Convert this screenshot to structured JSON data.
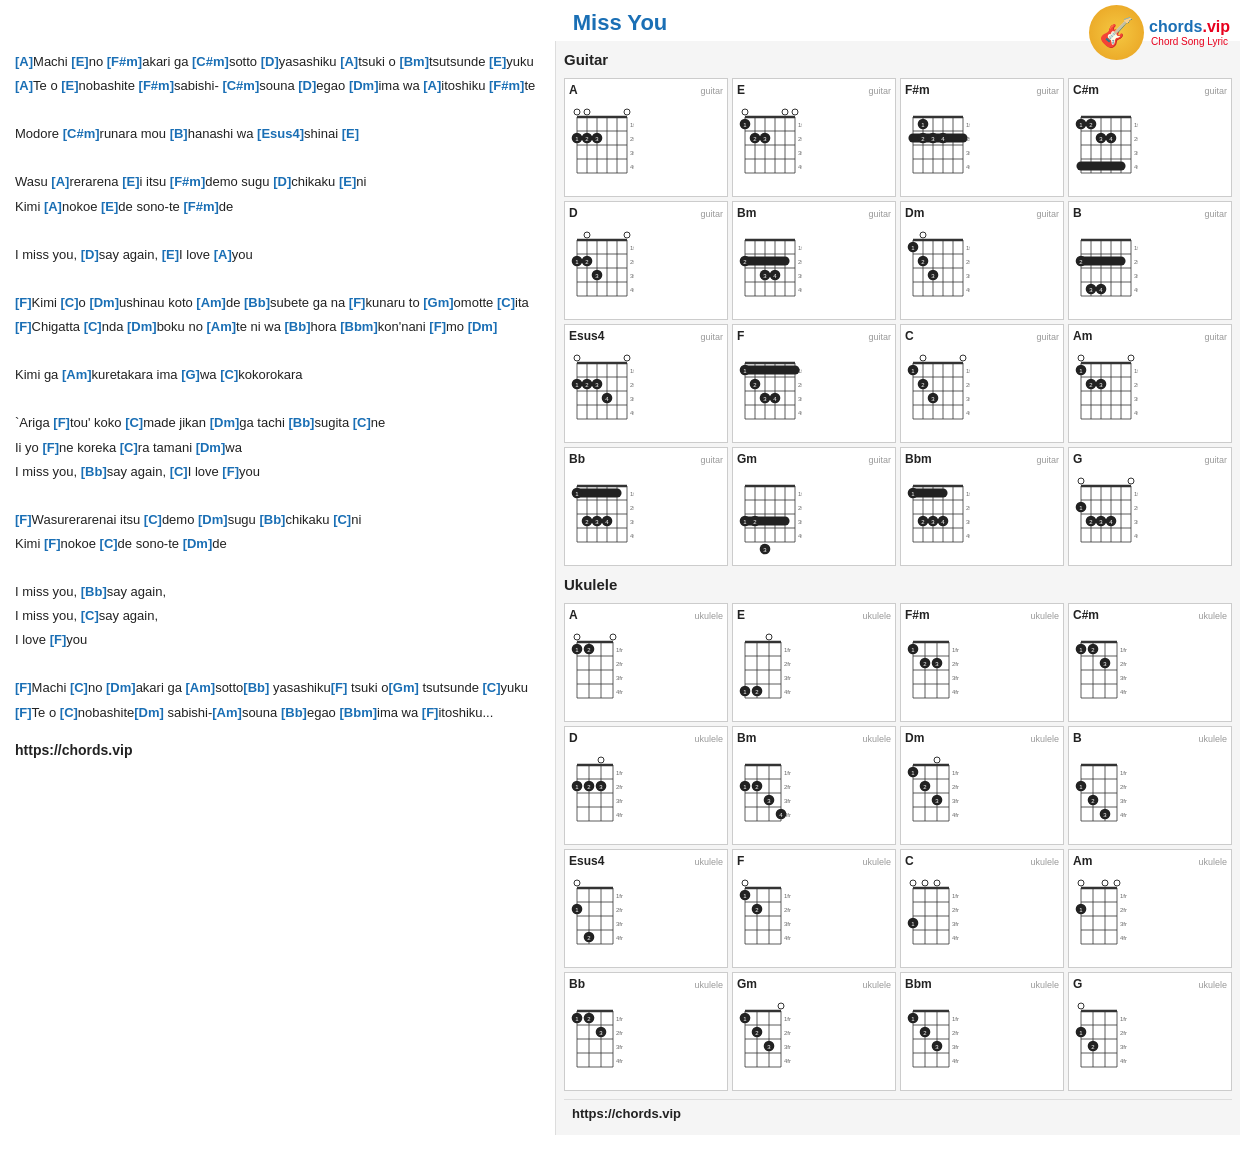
{
  "header": {
    "title": "Miss You",
    "logo_icon": "🎸",
    "logo_brand": "chords",
    "logo_brand_accent": ".vip",
    "logo_subtitle": "Chord Song Lyric"
  },
  "lyrics": {
    "lines": [
      {
        "parts": [
          {
            "type": "chord",
            "text": "[A]"
          },
          {
            "type": "text",
            "text": "Machi "
          },
          {
            "type": "chord",
            "text": "[E]"
          },
          {
            "type": "text",
            "text": "no "
          },
          {
            "type": "chord",
            "text": "[F#m]"
          },
          {
            "type": "text",
            "text": "akari ga "
          },
          {
            "type": "chord",
            "text": "[C#m]"
          },
          {
            "type": "text",
            "text": "sotto "
          },
          {
            "type": "chord",
            "text": "[D]"
          },
          {
            "type": "text",
            "text": "yasashiku "
          },
          {
            "type": "chord",
            "text": "[A]"
          },
          {
            "type": "text",
            "text": "tsuki o "
          },
          {
            "type": "chord",
            "text": "[Bm]"
          },
          {
            "type": "text",
            "text": "tsutsunde "
          },
          {
            "type": "chord",
            "text": "[E]"
          },
          {
            "type": "text",
            "text": "yuku"
          }
        ]
      },
      {
        "parts": [
          {
            "type": "chord",
            "text": "[A]"
          },
          {
            "type": "text",
            "text": "Te o "
          },
          {
            "type": "chord",
            "text": "[E]"
          },
          {
            "type": "text",
            "text": "nobashite "
          },
          {
            "type": "chord",
            "text": "[F#m]"
          },
          {
            "type": "text",
            "text": "sabishi- "
          },
          {
            "type": "chord",
            "text": "[C#m]"
          },
          {
            "type": "text",
            "text": "souna "
          },
          {
            "type": "chord",
            "text": "[D]"
          },
          {
            "type": "text",
            "text": "egao "
          },
          {
            "type": "chord",
            "text": "[Dm]"
          },
          {
            "type": "text",
            "text": "ima wa "
          },
          {
            "type": "chord",
            "text": "[A]"
          },
          {
            "type": "text",
            "text": "itoshiku "
          },
          {
            "type": "chord",
            "text": "[F#m]"
          },
          {
            "type": "text",
            "text": "te"
          }
        ]
      },
      {
        "parts": []
      },
      {
        "parts": [
          {
            "type": "text",
            "text": "Modore "
          },
          {
            "type": "chord",
            "text": "[C#m]"
          },
          {
            "type": "text",
            "text": "runara mou "
          },
          {
            "type": "chord",
            "text": "[B]"
          },
          {
            "type": "text",
            "text": "hanashi wa "
          },
          {
            "type": "chord",
            "text": "[Esus4]"
          },
          {
            "type": "text",
            "text": "shinai "
          },
          {
            "type": "chord",
            "text": "[E]"
          }
        ]
      },
      {
        "parts": []
      },
      {
        "parts": [
          {
            "type": "text",
            "text": "Wasu "
          },
          {
            "type": "chord",
            "text": "[A]"
          },
          {
            "type": "text",
            "text": "rerarena "
          },
          {
            "type": "chord",
            "text": "[E]"
          },
          {
            "type": "text",
            "text": "i itsu "
          },
          {
            "type": "chord",
            "text": "[F#m]"
          },
          {
            "type": "text",
            "text": "demo sugu "
          },
          {
            "type": "chord",
            "text": "[D]"
          },
          {
            "type": "text",
            "text": "chikaku "
          },
          {
            "type": "chord",
            "text": "[E]"
          },
          {
            "type": "text",
            "text": "ni"
          }
        ]
      },
      {
        "parts": [
          {
            "type": "text",
            "text": "Kimi "
          },
          {
            "type": "chord",
            "text": "[A]"
          },
          {
            "type": "text",
            "text": "nokoe "
          },
          {
            "type": "chord",
            "text": "[E]"
          },
          {
            "type": "text",
            "text": "de sono-te "
          },
          {
            "type": "chord",
            "text": "[F#m]"
          },
          {
            "type": "text",
            "text": "de"
          }
        ]
      },
      {
        "parts": []
      },
      {
        "parts": [
          {
            "type": "text",
            "text": "I miss you, "
          },
          {
            "type": "chord",
            "text": "[D]"
          },
          {
            "type": "text",
            "text": "say again, "
          },
          {
            "type": "chord",
            "text": "[E]"
          },
          {
            "type": "text",
            "text": "I love "
          },
          {
            "type": "chord",
            "text": "[A]"
          },
          {
            "type": "text",
            "text": "you"
          }
        ]
      },
      {
        "parts": []
      },
      {
        "parts": [
          {
            "type": "chord",
            "text": "[F]"
          },
          {
            "type": "text",
            "text": "Kimi "
          },
          {
            "type": "chord",
            "text": "[C]"
          },
          {
            "type": "text",
            "text": "o "
          },
          {
            "type": "chord",
            "text": "[Dm]"
          },
          {
            "type": "text",
            "text": "ushinau koto "
          },
          {
            "type": "chord",
            "text": "[Am]"
          },
          {
            "type": "text",
            "text": "de "
          },
          {
            "type": "chord",
            "text": "[Bb]"
          },
          {
            "type": "text",
            "text": "subete ga na "
          },
          {
            "type": "chord",
            "text": "[F]"
          },
          {
            "type": "text",
            "text": "kunaru to "
          },
          {
            "type": "chord",
            "text": "[Gm]"
          },
          {
            "type": "text",
            "text": "omotte "
          },
          {
            "type": "chord",
            "text": "[C]"
          },
          {
            "type": "text",
            "text": "ita"
          }
        ]
      },
      {
        "parts": [
          {
            "type": "chord",
            "text": "[F]"
          },
          {
            "type": "text",
            "text": "Chigatta "
          },
          {
            "type": "chord",
            "text": "[C]"
          },
          {
            "type": "text",
            "text": "nda "
          },
          {
            "type": "chord",
            "text": "[Dm]"
          },
          {
            "type": "text",
            "text": "boku no "
          },
          {
            "type": "chord",
            "text": "[Am]"
          },
          {
            "type": "text",
            "text": "te ni wa "
          },
          {
            "type": "chord",
            "text": "[Bb]"
          },
          {
            "type": "text",
            "text": "hora "
          },
          {
            "type": "chord",
            "text": "[Bbm]"
          },
          {
            "type": "text",
            "text": "kon'nani "
          },
          {
            "type": "chord",
            "text": "[F]"
          },
          {
            "type": "text",
            "text": "mo "
          },
          {
            "type": "chord",
            "text": "[Dm]"
          }
        ]
      },
      {
        "parts": []
      },
      {
        "parts": [
          {
            "type": "text",
            "text": "Kimi ga "
          },
          {
            "type": "chord",
            "text": "[Am]"
          },
          {
            "type": "text",
            "text": "kuretakara ima "
          },
          {
            "type": "chord",
            "text": "[G]"
          },
          {
            "type": "text",
            "text": "wa "
          },
          {
            "type": "chord",
            "text": "[C]"
          },
          {
            "type": "text",
            "text": "kokorokara"
          }
        ]
      },
      {
        "parts": []
      },
      {
        "parts": [
          {
            "type": "text",
            "text": "`Ariga "
          },
          {
            "type": "chord",
            "text": "[F]"
          },
          {
            "type": "text",
            "text": "tou' koko "
          },
          {
            "type": "chord",
            "text": "[C]"
          },
          {
            "type": "text",
            "text": "made jikan "
          },
          {
            "type": "chord",
            "text": "[Dm]"
          },
          {
            "type": "text",
            "text": "ga tachi "
          },
          {
            "type": "chord",
            "text": "[Bb]"
          },
          {
            "type": "text",
            "text": "sugita "
          },
          {
            "type": "chord",
            "text": "[C]"
          },
          {
            "type": "text",
            "text": "ne"
          }
        ]
      },
      {
        "parts": [
          {
            "type": "text",
            "text": "Ii yo "
          },
          {
            "type": "chord",
            "text": "[F]"
          },
          {
            "type": "text",
            "text": "ne koreka "
          },
          {
            "type": "chord",
            "text": "[C]"
          },
          {
            "type": "text",
            "text": "ra tamani "
          },
          {
            "type": "chord",
            "text": "[Dm]"
          },
          {
            "type": "text",
            "text": "wa"
          }
        ]
      },
      {
        "parts": [
          {
            "type": "text",
            "text": "I miss you, "
          },
          {
            "type": "chord",
            "text": "[Bb]"
          },
          {
            "type": "text",
            "text": "say again, "
          },
          {
            "type": "chord",
            "text": "[C]"
          },
          {
            "type": "text",
            "text": "I love "
          },
          {
            "type": "chord",
            "text": "[F]"
          },
          {
            "type": "text",
            "text": "you"
          }
        ]
      },
      {
        "parts": []
      },
      {
        "parts": [
          {
            "type": "chord",
            "text": "[F]"
          },
          {
            "type": "text",
            "text": "Wasurerarenai itsu "
          },
          {
            "type": "chord",
            "text": "[C]"
          },
          {
            "type": "text",
            "text": "demo "
          },
          {
            "type": "chord",
            "text": "[Dm]"
          },
          {
            "type": "text",
            "text": "sugu "
          },
          {
            "type": "chord",
            "text": "[Bb]"
          },
          {
            "type": "text",
            "text": "chikaku "
          },
          {
            "type": "chord",
            "text": "[C]"
          },
          {
            "type": "text",
            "text": "ni"
          }
        ]
      },
      {
        "parts": [
          {
            "type": "text",
            "text": "Kimi "
          },
          {
            "type": "chord",
            "text": "[F]"
          },
          {
            "type": "text",
            "text": "nokoe "
          },
          {
            "type": "chord",
            "text": "[C]"
          },
          {
            "type": "text",
            "text": "de sono-te "
          },
          {
            "type": "chord",
            "text": "[Dm]"
          },
          {
            "type": "text",
            "text": "de"
          }
        ]
      },
      {
        "parts": []
      },
      {
        "parts": [
          {
            "type": "text",
            "text": "I miss you, "
          },
          {
            "type": "chord",
            "text": "[Bb]"
          },
          {
            "type": "text",
            "text": "say again,"
          }
        ]
      },
      {
        "parts": [
          {
            "type": "text",
            "text": "I miss you, "
          },
          {
            "type": "chord",
            "text": "[C]"
          },
          {
            "type": "text",
            "text": "say again,"
          }
        ]
      },
      {
        "parts": [
          {
            "type": "text",
            "text": "I love "
          },
          {
            "type": "chord",
            "text": "[F]"
          },
          {
            "type": "text",
            "text": "you"
          }
        ]
      },
      {
        "parts": []
      },
      {
        "parts": [
          {
            "type": "chord",
            "text": "[F]"
          },
          {
            "type": "text",
            "text": "Machi "
          },
          {
            "type": "chord",
            "text": "[C]"
          },
          {
            "type": "text",
            "text": "no "
          },
          {
            "type": "chord",
            "text": "[Dm]"
          },
          {
            "type": "text",
            "text": "akari ga "
          },
          {
            "type": "chord",
            "text": "[Am]"
          },
          {
            "type": "text",
            "text": "sotto"
          },
          {
            "type": "chord",
            "text": "[Bb]"
          },
          {
            "type": "text",
            "text": " yasashiku"
          },
          {
            "type": "chord",
            "text": "[F]"
          },
          {
            "type": "text",
            "text": " tsuki o"
          },
          {
            "type": "chord",
            "text": "[Gm]"
          },
          {
            "type": "text",
            "text": " tsutsunde "
          },
          {
            "type": "chord",
            "text": "[C]"
          },
          {
            "type": "text",
            "text": "yuku"
          }
        ]
      },
      {
        "parts": [
          {
            "type": "chord",
            "text": "[F]"
          },
          {
            "type": "text",
            "text": "Te o "
          },
          {
            "type": "chord",
            "text": "[C]"
          },
          {
            "type": "text",
            "text": "nobashite"
          },
          {
            "type": "chord",
            "text": "[Dm]"
          },
          {
            "type": "text",
            "text": " sabishi-"
          },
          {
            "type": "chord",
            "text": "[Am]"
          },
          {
            "type": "text",
            "text": "souna "
          },
          {
            "type": "chord",
            "text": "[Bb]"
          },
          {
            "type": "text",
            "text": "egao "
          },
          {
            "type": "chord",
            "text": "[Bbm]"
          },
          {
            "type": "text",
            "text": "ima wa "
          },
          {
            "type": "chord",
            "text": "[F]"
          },
          {
            "type": "text",
            "text": "itoshiku..."
          }
        ]
      }
    ],
    "site_link": "https://chords.vip"
  },
  "chord_panel": {
    "guitar_title": "Guitar",
    "ukulele_title": "Ukulele",
    "bottom_link": "https://chords.vip",
    "guitar_chords": [
      {
        "name": "A",
        "type": "guitar"
      },
      {
        "name": "E",
        "type": "guitar"
      },
      {
        "name": "F#m",
        "type": "guitar"
      },
      {
        "name": "C#m",
        "type": "guitar"
      },
      {
        "name": "D",
        "type": "guitar"
      },
      {
        "name": "Bm",
        "type": "guitar"
      },
      {
        "name": "Dm",
        "type": "guitar"
      },
      {
        "name": "B",
        "type": "guitar"
      },
      {
        "name": "Esus4",
        "type": "guitar"
      },
      {
        "name": "F",
        "type": "guitar"
      },
      {
        "name": "C",
        "type": "guitar"
      },
      {
        "name": "Am",
        "type": "guitar"
      },
      {
        "name": "Bb",
        "type": "guitar"
      },
      {
        "name": "Gm",
        "type": "guitar"
      },
      {
        "name": "Bbm",
        "type": "guitar"
      },
      {
        "name": "G",
        "type": "guitar"
      }
    ],
    "ukulele_chords": [
      {
        "name": "A",
        "type": "ukulele"
      },
      {
        "name": "E",
        "type": "ukulele"
      },
      {
        "name": "F#m",
        "type": "ukulele"
      },
      {
        "name": "C#m",
        "type": "ukulele"
      },
      {
        "name": "D",
        "type": "ukulele"
      },
      {
        "name": "Bm",
        "type": "ukulele"
      },
      {
        "name": "Dm",
        "type": "ukulele"
      },
      {
        "name": "B",
        "type": "ukulele"
      },
      {
        "name": "Esus4",
        "type": "ukulele"
      },
      {
        "name": "F",
        "type": "ukulele"
      },
      {
        "name": "C",
        "type": "ukulele"
      },
      {
        "name": "Am",
        "type": "ukulele"
      },
      {
        "name": "Bb",
        "type": "ukulele"
      },
      {
        "name": "Gm",
        "type": "ukulele"
      },
      {
        "name": "Bbm",
        "type": "ukulele"
      },
      {
        "name": "G",
        "type": "ukulele"
      }
    ]
  }
}
